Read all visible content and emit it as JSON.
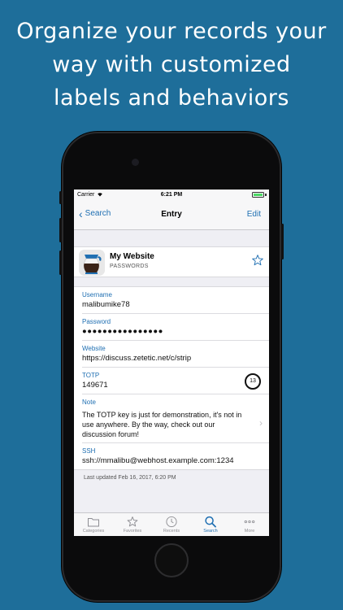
{
  "headline": [
    "Organize your records your",
    "way with customized",
    "labels and behaviors"
  ],
  "status": {
    "carrier": "Carrier",
    "time": "6:21 PM"
  },
  "nav": {
    "back_label": "Search",
    "title": "Entry",
    "edit_label": "Edit"
  },
  "entry": {
    "title": "My Website",
    "category": "PASSWORDS"
  },
  "fields": {
    "username": {
      "label": "Username",
      "value": "malibumike78"
    },
    "password": {
      "label": "Password",
      "value": "●●●●●●●●●●●●●●●●"
    },
    "website": {
      "label": "Website",
      "value": "https://discuss.zetetic.net/c/strip"
    },
    "totp": {
      "label": "TOTP",
      "value": "149671",
      "timer": "13"
    },
    "note": {
      "label": "Note",
      "value": "The TOTP key is just for demonstration, it's not in use anywhere. By the way, check out our discussion forum!"
    },
    "ssh": {
      "label": "SSH",
      "value": "ssh://mmalibu@webhost.example.com:1234"
    }
  },
  "last_updated": "Last updated Feb 16, 2017, 6:20 PM",
  "tabs": [
    {
      "label": "Categories",
      "icon": "folder-icon"
    },
    {
      "label": "Favorites",
      "icon": "star-icon"
    },
    {
      "label": "Recents",
      "icon": "clock-icon"
    },
    {
      "label": "Search",
      "icon": "search-icon",
      "active": true
    },
    {
      "label": "More",
      "icon": "more-icon"
    }
  ],
  "colors": {
    "background": "#1e6e9a",
    "accent": "#1f6fb2"
  }
}
